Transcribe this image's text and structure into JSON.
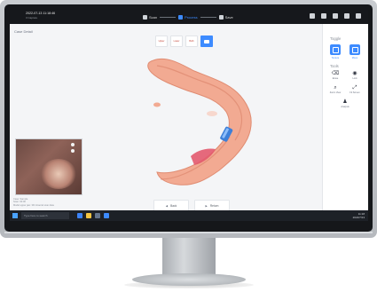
{
  "header": {
    "datetime": "2022-07-13 11:18:46",
    "subtitle": "3 Capture",
    "steps": [
      {
        "label": "Scan",
        "state": "done"
      },
      {
        "label": "Process",
        "state": "active"
      },
      {
        "label": "Save",
        "state": "pending"
      }
    ]
  },
  "workspace": {
    "case_title": "Case Detail",
    "view_tabs": [
      "Upper",
      "Lower",
      "Both"
    ],
    "info_lines": [
      "Case: Sample",
      "Scan: 00:00",
      "Model upper jaw: 3D intraoral scan data"
    ],
    "buttons": {
      "back": "Back",
      "next": "Return"
    }
  },
  "panel": {
    "toggle_title": "Toggle",
    "toggle_items": [
      "Texture",
      "Mono"
    ],
    "tools_title": "Tools",
    "tools": [
      {
        "label": "Erase",
        "icon": "eraser-icon"
      },
      {
        "label": "Lock",
        "icon": "eye-icon"
      },
      {
        "label": "Zoom View",
        "icon": "magnifier-icon"
      },
      {
        "label": "Fit Screen",
        "icon": "fit-screen-icon"
      },
      {
        "label": "Analysis",
        "icon": "person-icon"
      }
    ]
  },
  "taskbar": {
    "search_placeholder": "Type here to search",
    "time": "11:18",
    "date": "2022/7/13"
  },
  "colors": {
    "accent": "#3d8bff",
    "tissue": "#f0a58c",
    "implant": "#3d7fd8",
    "topbar": "#16181c"
  }
}
